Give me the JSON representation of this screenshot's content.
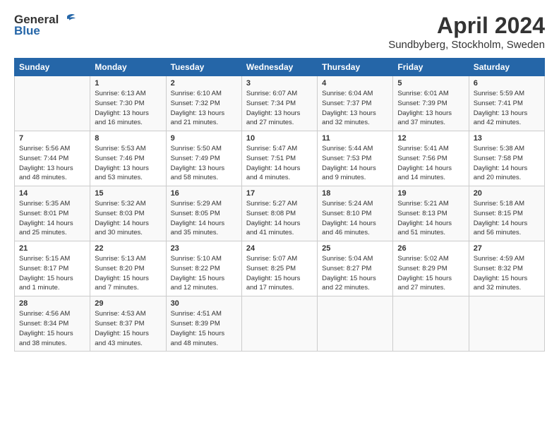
{
  "header": {
    "logo_general": "General",
    "logo_blue": "Blue",
    "month_title": "April 2024",
    "location": "Sundbyberg, Stockholm, Sweden"
  },
  "days_of_week": [
    "Sunday",
    "Monday",
    "Tuesday",
    "Wednesday",
    "Thursday",
    "Friday",
    "Saturday"
  ],
  "weeks": [
    [
      {
        "day": "",
        "info": ""
      },
      {
        "day": "1",
        "info": "Sunrise: 6:13 AM\nSunset: 7:30 PM\nDaylight: 13 hours\nand 16 minutes."
      },
      {
        "day": "2",
        "info": "Sunrise: 6:10 AM\nSunset: 7:32 PM\nDaylight: 13 hours\nand 21 minutes."
      },
      {
        "day": "3",
        "info": "Sunrise: 6:07 AM\nSunset: 7:34 PM\nDaylight: 13 hours\nand 27 minutes."
      },
      {
        "day": "4",
        "info": "Sunrise: 6:04 AM\nSunset: 7:37 PM\nDaylight: 13 hours\nand 32 minutes."
      },
      {
        "day": "5",
        "info": "Sunrise: 6:01 AM\nSunset: 7:39 PM\nDaylight: 13 hours\nand 37 minutes."
      },
      {
        "day": "6",
        "info": "Sunrise: 5:59 AM\nSunset: 7:41 PM\nDaylight: 13 hours\nand 42 minutes."
      }
    ],
    [
      {
        "day": "7",
        "info": "Sunrise: 5:56 AM\nSunset: 7:44 PM\nDaylight: 13 hours\nand 48 minutes."
      },
      {
        "day": "8",
        "info": "Sunrise: 5:53 AM\nSunset: 7:46 PM\nDaylight: 13 hours\nand 53 minutes."
      },
      {
        "day": "9",
        "info": "Sunrise: 5:50 AM\nSunset: 7:49 PM\nDaylight: 13 hours\nand 58 minutes."
      },
      {
        "day": "10",
        "info": "Sunrise: 5:47 AM\nSunset: 7:51 PM\nDaylight: 14 hours\nand 4 minutes."
      },
      {
        "day": "11",
        "info": "Sunrise: 5:44 AM\nSunset: 7:53 PM\nDaylight: 14 hours\nand 9 minutes."
      },
      {
        "day": "12",
        "info": "Sunrise: 5:41 AM\nSunset: 7:56 PM\nDaylight: 14 hours\nand 14 minutes."
      },
      {
        "day": "13",
        "info": "Sunrise: 5:38 AM\nSunset: 7:58 PM\nDaylight: 14 hours\nand 20 minutes."
      }
    ],
    [
      {
        "day": "14",
        "info": "Sunrise: 5:35 AM\nSunset: 8:01 PM\nDaylight: 14 hours\nand 25 minutes."
      },
      {
        "day": "15",
        "info": "Sunrise: 5:32 AM\nSunset: 8:03 PM\nDaylight: 14 hours\nand 30 minutes."
      },
      {
        "day": "16",
        "info": "Sunrise: 5:29 AM\nSunset: 8:05 PM\nDaylight: 14 hours\nand 35 minutes."
      },
      {
        "day": "17",
        "info": "Sunrise: 5:27 AM\nSunset: 8:08 PM\nDaylight: 14 hours\nand 41 minutes."
      },
      {
        "day": "18",
        "info": "Sunrise: 5:24 AM\nSunset: 8:10 PM\nDaylight: 14 hours\nand 46 minutes."
      },
      {
        "day": "19",
        "info": "Sunrise: 5:21 AM\nSunset: 8:13 PM\nDaylight: 14 hours\nand 51 minutes."
      },
      {
        "day": "20",
        "info": "Sunrise: 5:18 AM\nSunset: 8:15 PM\nDaylight: 14 hours\nand 56 minutes."
      }
    ],
    [
      {
        "day": "21",
        "info": "Sunrise: 5:15 AM\nSunset: 8:17 PM\nDaylight: 15 hours\nand 1 minute."
      },
      {
        "day": "22",
        "info": "Sunrise: 5:13 AM\nSunset: 8:20 PM\nDaylight: 15 hours\nand 7 minutes."
      },
      {
        "day": "23",
        "info": "Sunrise: 5:10 AM\nSunset: 8:22 PM\nDaylight: 15 hours\nand 12 minutes."
      },
      {
        "day": "24",
        "info": "Sunrise: 5:07 AM\nSunset: 8:25 PM\nDaylight: 15 hours\nand 17 minutes."
      },
      {
        "day": "25",
        "info": "Sunrise: 5:04 AM\nSunset: 8:27 PM\nDaylight: 15 hours\nand 22 minutes."
      },
      {
        "day": "26",
        "info": "Sunrise: 5:02 AM\nSunset: 8:29 PM\nDaylight: 15 hours\nand 27 minutes."
      },
      {
        "day": "27",
        "info": "Sunrise: 4:59 AM\nSunset: 8:32 PM\nDaylight: 15 hours\nand 32 minutes."
      }
    ],
    [
      {
        "day": "28",
        "info": "Sunrise: 4:56 AM\nSunset: 8:34 PM\nDaylight: 15 hours\nand 38 minutes."
      },
      {
        "day": "29",
        "info": "Sunrise: 4:53 AM\nSunset: 8:37 PM\nDaylight: 15 hours\nand 43 minutes."
      },
      {
        "day": "30",
        "info": "Sunrise: 4:51 AM\nSunset: 8:39 PM\nDaylight: 15 hours\nand 48 minutes."
      },
      {
        "day": "",
        "info": ""
      },
      {
        "day": "",
        "info": ""
      },
      {
        "day": "",
        "info": ""
      },
      {
        "day": "",
        "info": ""
      }
    ]
  ]
}
